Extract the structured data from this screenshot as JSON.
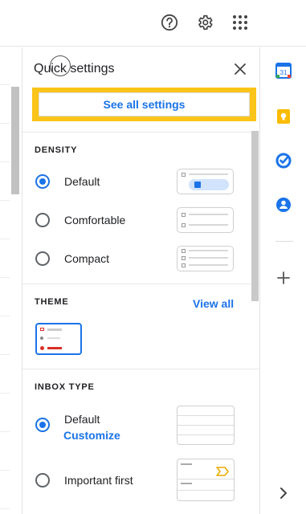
{
  "quick_settings": {
    "title": "Quick settings",
    "see_all_label": "See all settings",
    "density": {
      "label": "DENSITY",
      "options": [
        {
          "label": "Default",
          "selected": true
        },
        {
          "label": "Comfortable",
          "selected": false
        },
        {
          "label": "Compact",
          "selected": false
        }
      ]
    },
    "theme": {
      "label": "THEME",
      "view_all_label": "View all"
    },
    "inbox_type": {
      "label": "INBOX TYPE",
      "options": [
        {
          "label": "Default",
          "selected": true
        },
        {
          "label": "Important first",
          "selected": false
        }
      ],
      "customize_label": "Customize"
    }
  },
  "side_panel": {
    "calendar_day": "31"
  },
  "colors": {
    "accent": "#1a73e8",
    "highlight": "#fbc419"
  },
  "icons": [
    "help-icon",
    "gear-icon",
    "apps-icon",
    "close-icon",
    "calendar-icon",
    "keep-icon",
    "tasks-icon",
    "contacts-icon",
    "plus-icon",
    "chevron-right-icon"
  ]
}
